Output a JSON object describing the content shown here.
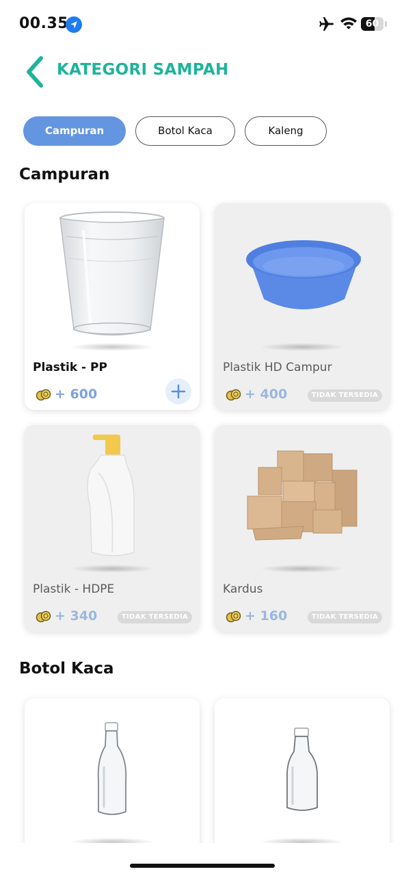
{
  "status_bar": {
    "time": "00.35",
    "battery": "60",
    "icons": [
      "location-icon",
      "airplane-icon",
      "wifi-icon",
      "battery-icon"
    ]
  },
  "header": {
    "title": "KATEGORI SAMPAH",
    "back_icon": "chevron-left-icon"
  },
  "tabs": [
    {
      "label": "Campuran",
      "active": true
    },
    {
      "label": "Botol Kaca",
      "active": false
    },
    {
      "label": "Kaleng",
      "active": false
    }
  ],
  "sections": [
    {
      "title": "Campuran",
      "items": [
        {
          "name": "Plastik - PP",
          "points": "+ 600",
          "available": true,
          "action_icon": "plus-icon"
        },
        {
          "name": "Plastik HD Campur",
          "points": "+ 400",
          "available": false,
          "status": "TIDAK TERSEDIA"
        },
        {
          "name": "Plastik - HDPE",
          "points": "+ 340",
          "available": false,
          "status": "TIDAK TERSEDIA"
        },
        {
          "name": "Kardus",
          "points": "+ 160",
          "available": false,
          "status": "TIDAK TERSEDIA"
        }
      ]
    },
    {
      "title": "Botol Kaca",
      "items": [
        {
          "name": "",
          "points": "",
          "available": true
        },
        {
          "name": "",
          "points": "",
          "available": true
        }
      ]
    }
  ],
  "colors": {
    "accent": "#1fb39b",
    "tab_active": "#6495e0",
    "points": "#7fa3d8",
    "card_disabled": "#efefef"
  }
}
